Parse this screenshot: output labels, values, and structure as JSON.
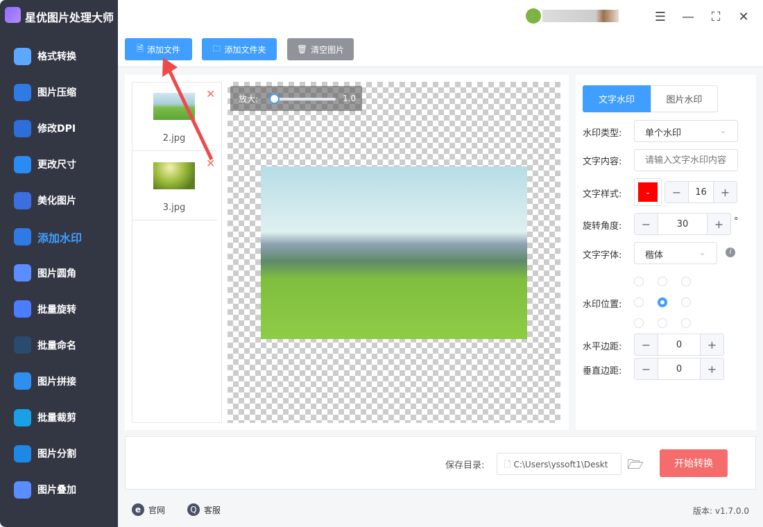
{
  "app": {
    "title": "星优图片处理大师"
  },
  "sidebar": {
    "items": [
      {
        "label": "格式转换",
        "icon": "format-convert-icon",
        "color": "#5aa8ff"
      },
      {
        "label": "图片压缩",
        "icon": "compress-icon",
        "color": "#2f7be5"
      },
      {
        "label": "修改DPI",
        "icon": "dpi-icon",
        "color": "#2d6fd8"
      },
      {
        "label": "更改尺寸",
        "icon": "resize-icon",
        "color": "#2a8bf2"
      },
      {
        "label": "美化图片",
        "icon": "beautify-icon",
        "color": "#3b6fe0"
      },
      {
        "label": "添加水印",
        "icon": "watermark-icon",
        "color": "#2f7be5",
        "active": true
      },
      {
        "label": "图片圆角",
        "icon": "round-corner-icon",
        "color": "#5a8dff"
      },
      {
        "label": "批量旋转",
        "icon": "rotate-icon",
        "color": "#4a7dff"
      },
      {
        "label": "批量命名",
        "icon": "rename-icon",
        "color": "#2a4a6e"
      },
      {
        "label": "图片拼接",
        "icon": "puzzle-icon",
        "color": "#2e8ff0"
      },
      {
        "label": "批量裁剪",
        "icon": "crop-icon",
        "color": "#1aa0e6"
      },
      {
        "label": "图片分割",
        "icon": "split-icon",
        "color": "#1e88e5"
      },
      {
        "label": "图片叠加",
        "icon": "layers-icon",
        "color": "#5a8dff"
      }
    ]
  },
  "toolbar": {
    "add_file": "添加文件",
    "add_folder": "添加文件夹",
    "clear": "清空图片"
  },
  "files": [
    {
      "name": "2.jpg"
    },
    {
      "name": "3.jpg"
    }
  ],
  "preview": {
    "zoom_label": "放大:",
    "zoom_value": "1.0",
    "zoom_fraction": 0.0
  },
  "settings": {
    "tabs": [
      "文字水印",
      "图片水印"
    ],
    "type_label": "水印类型:",
    "type_value": "单个水印",
    "content_label": "文字内容:",
    "content_placeholder": "请输入文字水印内容",
    "style_label": "文字样式:",
    "color": "#ff0000",
    "size": "16",
    "rotate_label": "旋转角度:",
    "rotate": "30",
    "degree": "°",
    "font_label": "文字字体:",
    "font_value": "楷体",
    "position_label": "水印位置:",
    "position_selected": 4,
    "hmargin_label": "水平边距:",
    "hmargin": "0",
    "vmargin_label": "垂直边距:",
    "vmargin": "0"
  },
  "bottom": {
    "save_label": "保存目录:",
    "save_path": "C:\\Users\\yssoft1\\Deskt",
    "start": "开始转换"
  },
  "footer": {
    "site": "官网",
    "service": "客服",
    "version": "版本: v1.7.0.0"
  }
}
